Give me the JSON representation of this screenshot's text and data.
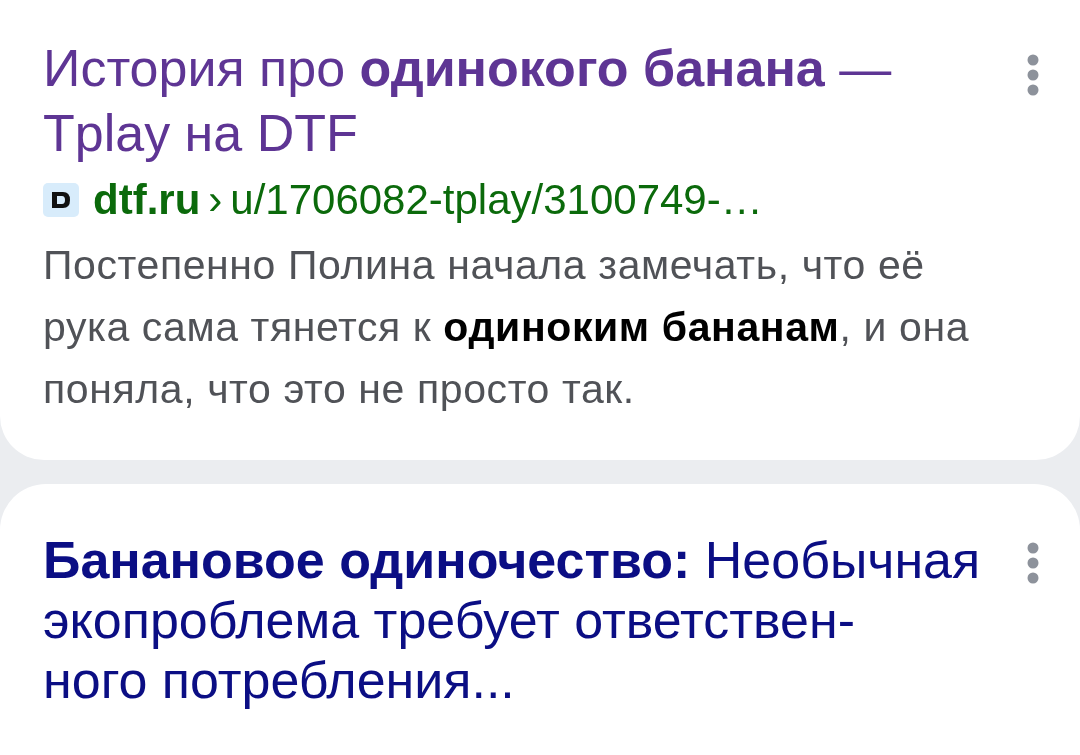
{
  "results": [
    {
      "title": "История про **одинокого банана** — Tplay на DTF",
      "visited": true,
      "url": {
        "domain": "dtf.ru",
        "separator": "›",
        "path": "u/1706082-tplay/3100749-…"
      },
      "snippet": "Постепенно Полина начала замечать, что её рука сама тянется к **одиноким бананам**, и она поняла, что это не просто так."
    },
    {
      "title": "**Банановое одиночество:** Необычная экопроблема требует ответствен-\nного потребления...",
      "visited": false
    }
  ]
}
